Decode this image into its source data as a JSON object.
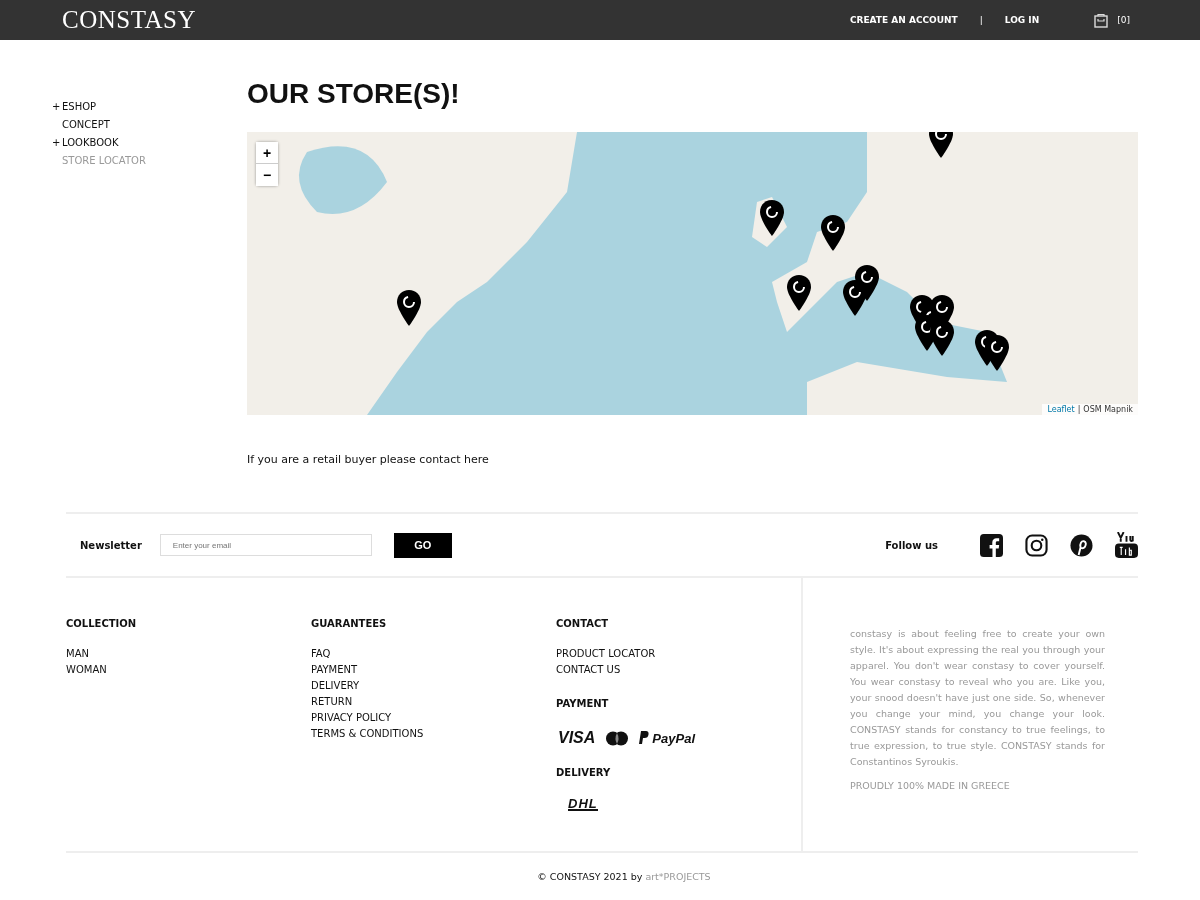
{
  "header": {
    "logo": "CONSTASY",
    "links": [
      "CREATE AN ACCOUNT",
      "LOG IN"
    ],
    "separator": "|",
    "cart_count": "[0]"
  },
  "sidebar": {
    "items": [
      {
        "prefix": "+",
        "label": "ESHOP",
        "selected": false
      },
      {
        "label": "CONCEPT",
        "selected": false
      },
      {
        "prefix": "+",
        "label": "LOOKBOOK",
        "selected": false
      },
      {
        "label": "STORE LOCATOR",
        "selected": true
      }
    ]
  },
  "page": {
    "title": "OUR STORE(S)!",
    "map": {
      "kind": "picture",
      "zoom_in": "+",
      "zoom_out": "−",
      "attribution_link": "Leaflet",
      "attribution_separator": "|",
      "attribution_text": "OSM Mapnik"
    },
    "note": "If you are a retail buyer please contact here"
  },
  "newsletter": {
    "label": "Newsletter",
    "placeholder": "Enter your email",
    "button": "GO",
    "follow": "Follow us"
  },
  "footer": {
    "columns": [
      {
        "title": "COLLECTION",
        "links": [
          "MAN",
          "WOMAN"
        ]
      },
      {
        "title": "GUARANTEES",
        "links": [
          "FAQ",
          "PAYMENT",
          "DELIVERY",
          "RETURN",
          "PRIVACY POLICY",
          "TERMS & CONDITIONS"
        ]
      },
      {
        "title": "CONTACT",
        "links": [
          "PRODUCT LOCATOR",
          "CONTACT US"
        ],
        "payment_title": "PAYMENT",
        "payment_logos": [
          "VISA",
          "PayPal"
        ],
        "delivery_title": "DELIVERY",
        "delivery_logo": "DHL"
      }
    ],
    "about": "constasy is about feeling free to create your own style. It's about expressing the real you through your apparel. You don't wear constasy to cover yourself. You wear constasy to reveal who you are. Like you, your snood doesn't have just one side. So, whenever you change your mind, you change your look. CONSTASY stands for constancy to true feelings, to true expression, to true style. CONSTASY stands for Constantinos Syroukis.",
    "made_in": "PROUDLY 100% MADE IN GREECE",
    "copyright": "© CONSTASY 2021 by",
    "credit_link": "art*PROJECTS"
  }
}
